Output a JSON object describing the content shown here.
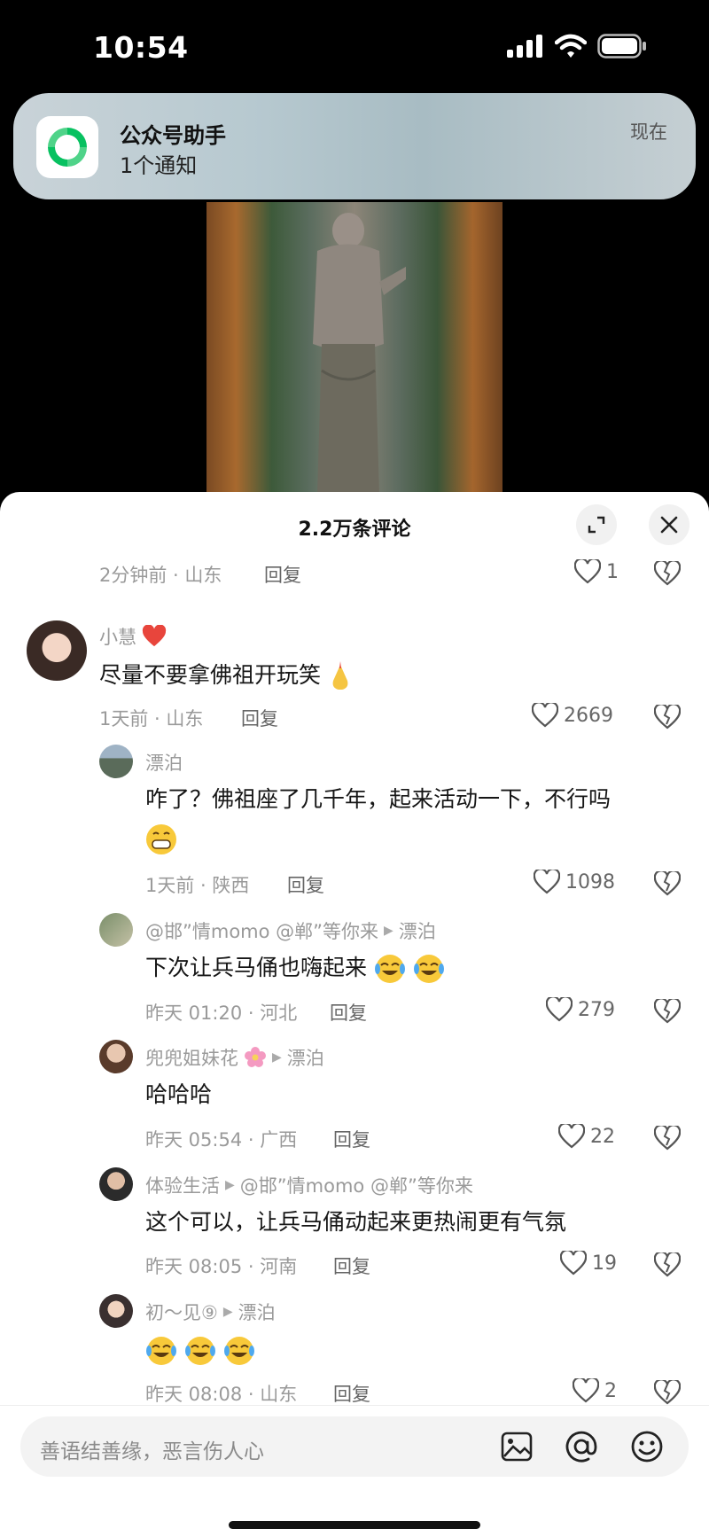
{
  "status": {
    "time": "10:54"
  },
  "notification": {
    "app": "公众号助手",
    "text": "1个通知",
    "time": "现在"
  },
  "sheet": {
    "title": "2.2万条评论"
  },
  "top_comment": {
    "time_loc": "2分钟前 · 山东",
    "reply": "回复",
    "likes": "1"
  },
  "comments": [
    {
      "name": "小慧",
      "text": "尽量不要拿佛祖开玩笑",
      "time_loc": "1天前 · 山东",
      "reply": "回复",
      "likes": "2669"
    },
    {
      "name": "漂泊",
      "text": "咋了？佛祖座了几千年，起来活动一下，不行吗",
      "time_loc": "1天前 · 陕西",
      "reply": "回复",
      "likes": "1098"
    },
    {
      "name": "@邯”情momo @郸”等你来",
      "reply_to": "漂泊",
      "text": "下次让兵马俑也嗨起来",
      "time_loc": "昨天 01:20 · 河北",
      "reply": "回复",
      "likes": "279"
    },
    {
      "name": "兜兜姐妹花",
      "reply_to": "漂泊",
      "text": "哈哈哈",
      "time_loc": "昨天 05:54 · 广西",
      "reply": "回复",
      "likes": "22"
    },
    {
      "name": "体验生活",
      "reply_to": "@邯”情momo @郸”等你来",
      "text": "这个可以，让兵马俑动起来更热闹更有气氛",
      "time_loc": "昨天 08:05 · 河南",
      "reply": "回复",
      "likes": "19"
    },
    {
      "name": "初～见⑨",
      "reply_to": "漂泊",
      "text": "",
      "time_loc": "昨天 08:08 · 山东",
      "reply": "回复",
      "likes": "2"
    }
  ],
  "input": {
    "placeholder": "善语结善缘，恶言伤人心"
  },
  "icons": {
    "signal": "signal-icon",
    "wifi": "wifi-icon",
    "battery": "battery-icon",
    "expand": "expand-icon",
    "close": "close-icon",
    "heart": "heart-icon",
    "broken_heart": "broken-heart-icon",
    "image": "image-icon",
    "at": "at-icon",
    "emoji": "emoji-icon"
  },
  "colors": {
    "accent_red": "#e8453c",
    "wechat_green": "#07c160"
  }
}
